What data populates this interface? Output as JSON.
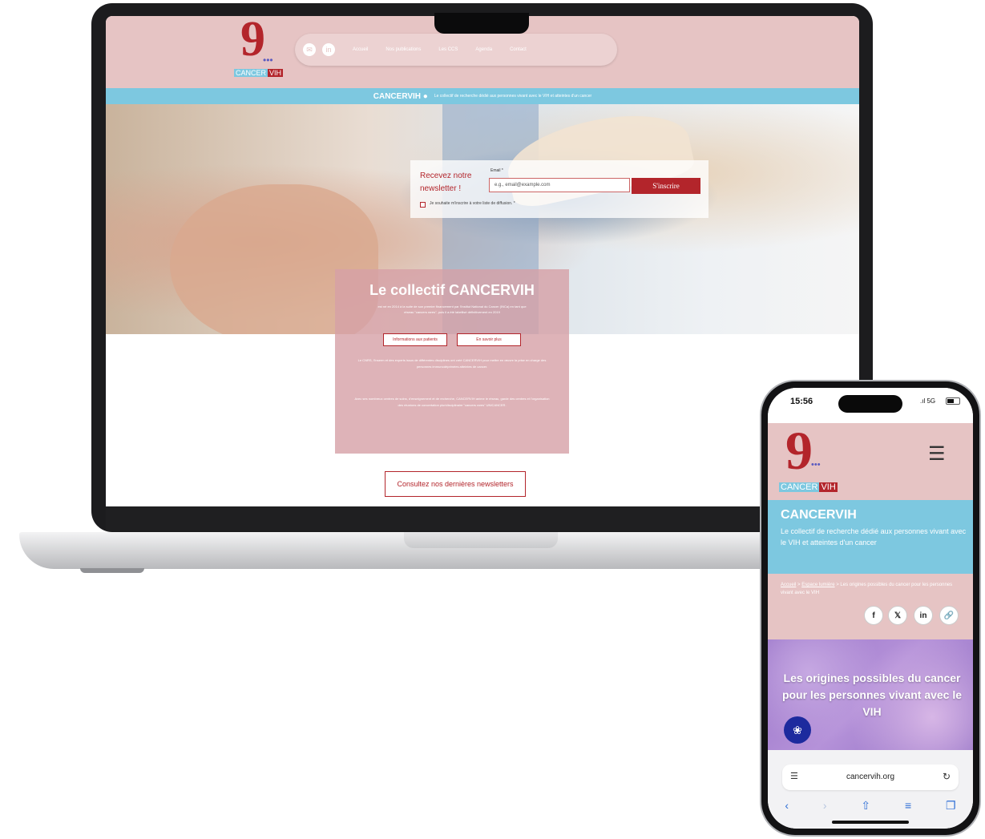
{
  "desktop": {
    "logo": {
      "number": "9",
      "dots": "•••",
      "text_a": "CANCER",
      "text_b": "VIH"
    },
    "nav": {
      "icons": [
        "mail-icon",
        "linkedin-icon"
      ],
      "mail_glyph": "✉",
      "linkedin_glyph": "in",
      "items": [
        "Accueil",
        "Nos publications",
        "Les CCS",
        "Agenda",
        "Contact"
      ]
    },
    "banner": {
      "title": "CANCERVIH ●",
      "subtitle": "Le collectif de recherche dédié aux personnes vivant avec le VIH et atteintes d'un cancer"
    },
    "newsletter": {
      "title": "Recevez notre newsletter !",
      "email_label": "Email *",
      "email_placeholder": "e.g., email@example.com",
      "submit": "S'inscrire",
      "consent": "Je souhaite m'inscrire à votre liste de diffusion. *"
    },
    "collectif": {
      "title": "Le collectif CANCERVIH",
      "subtitle": "est né en 2014 à la suite de son premier financement par l'Institut National du Cancer (INCa) en tant que réseau \"cancers rares\", puis il a été labellisé définitivement en 2019",
      "button_patients": "Informations aux patients",
      "button_more": "En savoir plus",
      "text1": "Le CNRS, l'Inserm et des experts issus de différentes disciplines ont créé CANCERVIH pour mettre en œuvre la prise en charge des personnes immunodéprimées atteintes de cancer.",
      "text2": "Avec ses nombreux centres de soins, d'enseignement et de recherche, CANCERVIH anime le réseau, garde des centres et l'organisation des réunions de concertation pluridisciplinaire \"cancers rares\" UNICANCER."
    },
    "consult_button": "Consultez nos dernières newsletters"
  },
  "phone": {
    "time": "15:56",
    "signal": ".ıl 5G",
    "logo": {
      "number": "9",
      "dots": "•••",
      "text_a": "CANCER",
      "text_b": "VIH"
    },
    "menu_glyph": "☰",
    "banner": {
      "title": "CANCERVIH",
      "subtitle": "Le collectif de recherche dédié aux personnes vivant avec le VIH et atteintes d'un cancer"
    },
    "breadcrumb": {
      "home": "Accueil",
      "section": "Espace lumière",
      "current": "Les origines possibles du cancer pour les personnes vivant avec le VIH",
      "separator": " > "
    },
    "share_icons": [
      {
        "name": "facebook-icon",
        "glyph": "f"
      },
      {
        "name": "x-icon",
        "glyph": "𝕏"
      },
      {
        "name": "linkedin-icon",
        "glyph": "in"
      },
      {
        "name": "link-icon",
        "glyph": "🔗"
      }
    ],
    "article_title": "Les origines possibles du cancer pour les personnes vivant avec le VIH",
    "fab_glyph": "❀",
    "url": "cancervih.org",
    "url_icon": "☰",
    "reload_glyph": "↻",
    "toolbar": {
      "back": "‹",
      "forward": "›",
      "share": "⇧",
      "bookmarks": "≡",
      "tabs": "❐"
    }
  }
}
